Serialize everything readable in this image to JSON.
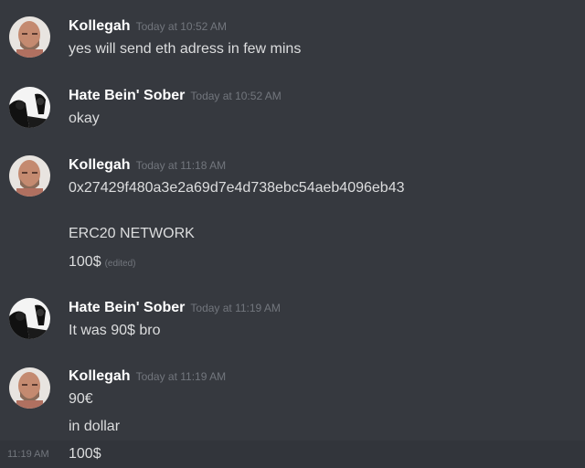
{
  "messages": [
    {
      "author": "Kollegah",
      "timestamp": "Today at 10:52 AM",
      "avatar": "bald-man-avatar",
      "lines": [
        "yes will send eth adress in few mins"
      ]
    },
    {
      "author": "Hate Bein' Sober",
      "timestamp": "Today at 10:52 AM",
      "avatar": "bw-figure-avatar",
      "lines": [
        "okay"
      ]
    },
    {
      "author": "Kollegah",
      "timestamp": "Today at 11:18 AM",
      "avatar": "bald-man-avatar",
      "lines": [
        "0x27429f480a3e2a69d7e4d738ebc54aeb4096eb43",
        "ERC20 NETWORK",
        "100$"
      ],
      "edited_label": "(edited)"
    },
    {
      "author": "Hate Bein' Sober",
      "timestamp": "Today at 11:19 AM",
      "avatar": "bw-figure-avatar",
      "lines": [
        "It was 90$ bro"
      ]
    },
    {
      "author": "Kollegah",
      "timestamp": "Today at 11:19 AM",
      "avatar": "bald-man-avatar",
      "lines": [
        "90€",
        "in dollar",
        "100$"
      ],
      "hover_timestamp": "11:19 AM"
    }
  ],
  "colors": {
    "background": "#36393f",
    "hover_background": "#32353b",
    "author": "#ffffff",
    "text": "#dcddde",
    "muted": "#72767d"
  }
}
